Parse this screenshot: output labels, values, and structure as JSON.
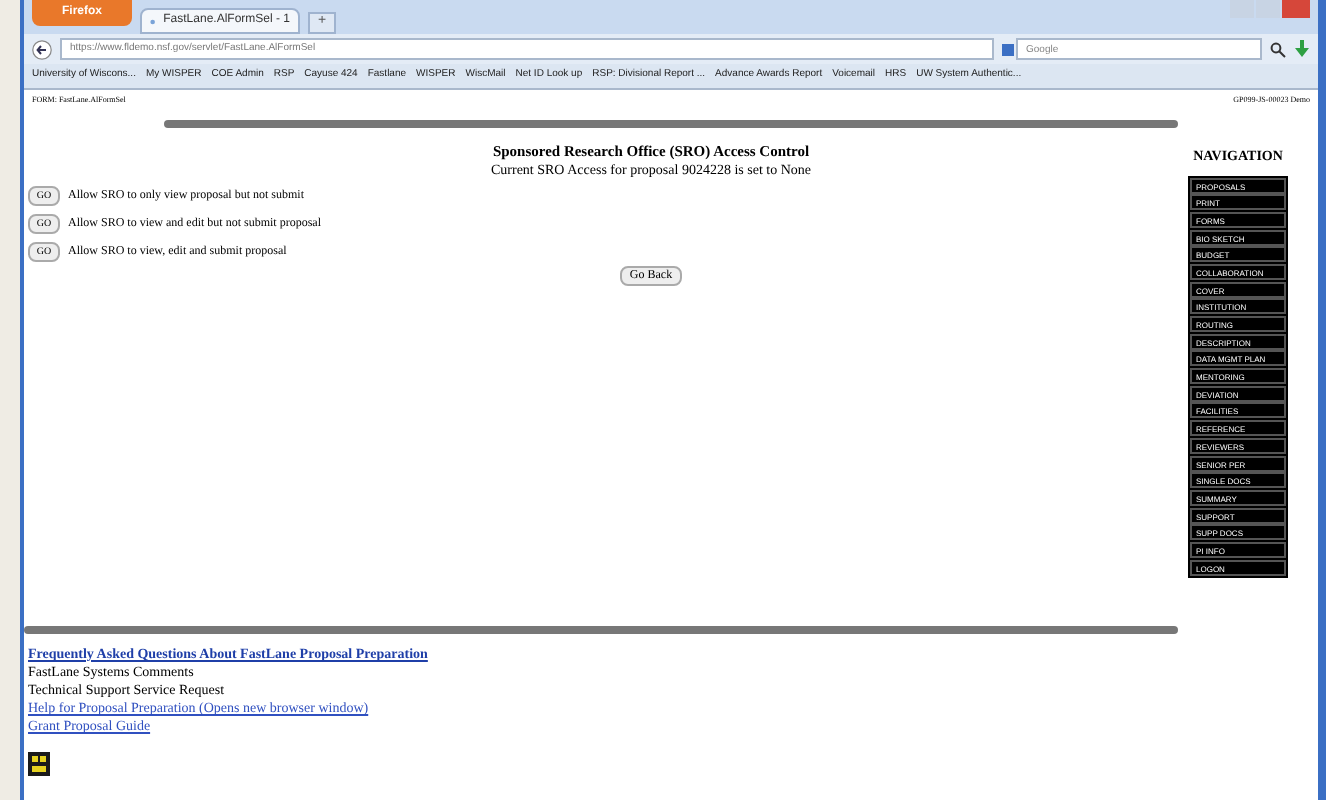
{
  "browser": {
    "menu_button": "Firefox",
    "tab": "FastLane.AlFormSel - 1",
    "new_tab": "+",
    "address": "https://www.fldemo.nsf.gov/servlet/FastLane.AlFormSel",
    "search_placeholder": "Google",
    "bookmarks": [
      "University of Wiscons...",
      "My WISPER",
      "COE Admin",
      "RSP",
      "Cayuse 424",
      "Fastlane",
      "WISPER",
      "WiscMail",
      "Net ID Look up",
      "RSP: Divisional Report ...",
      "Advance Awards Report",
      "Voicemail",
      "HRS",
      "UW System Authentic..."
    ]
  },
  "page": {
    "form_id": "FORM: FastLane.AlFormSel",
    "session_id": "GP099-JS-00023 Demo",
    "title": "Sponsored Research Office (SRO) Access Control",
    "subtitle": "Current SRO Access for proposal 9024228 is set to None",
    "options": [
      {
        "button": "GO",
        "label": "Allow SRO to only view proposal but not submit"
      },
      {
        "button": "GO",
        "label": "Allow SRO to view and edit but not submit proposal"
      },
      {
        "button": "GO",
        "label": "Allow SRO to view, edit and submit proposal"
      }
    ],
    "back_button": "Go Back",
    "navigation": {
      "heading": "NAVIGATION",
      "items": [
        "PROPOSALS",
        "PRINT",
        "FORMS",
        "BIO SKETCH",
        "BUDGET",
        "COLLABORATION",
        "COVER",
        "INSTITUTION",
        "ROUTING",
        "DESCRIPTION",
        "DATA MGMT PLAN",
        "MENTORING",
        "DEVIATION",
        "FACILITIES",
        "REFERENCE",
        "REVIEWERS",
        "SENIOR PER",
        "SINGLE DOCS",
        "SUMMARY",
        "SUPPORT",
        "SUPP DOCS",
        "PI INFO",
        "LOGON"
      ]
    },
    "footer_links": [
      {
        "kind": "bold-link",
        "text": "Frequently Asked Questions About FastLane Proposal Preparation"
      },
      {
        "kind": "plain",
        "text": "FastLane Systems Comments"
      },
      {
        "kind": "plain",
        "text": "Technical Support Service Request"
      },
      {
        "kind": "link",
        "text": "Help for Proposal Preparation (Opens new browser window)"
      },
      {
        "kind": "link",
        "text": "Grant Proposal Guide"
      }
    ]
  }
}
